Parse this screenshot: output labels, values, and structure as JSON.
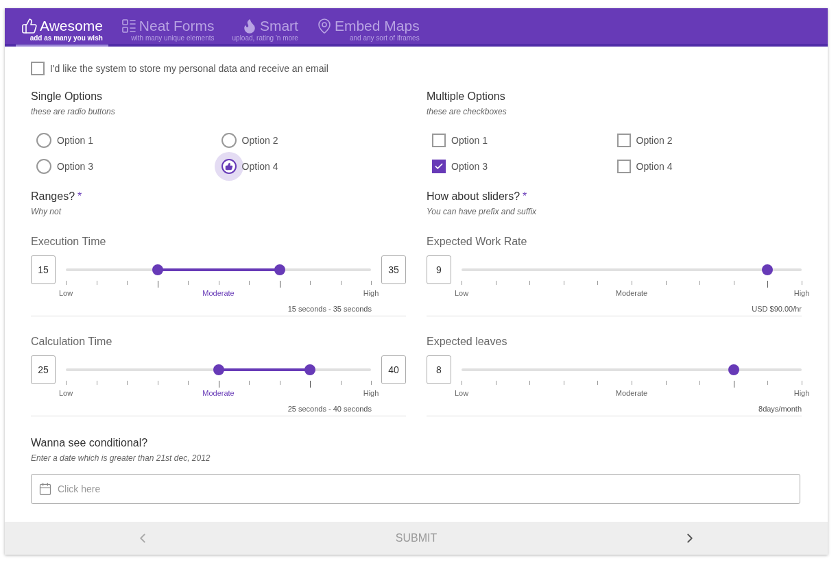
{
  "tabs": [
    {
      "title": "Awesome",
      "subtitle": "add as many you wish",
      "selected": true
    },
    {
      "title": "Neat Forms",
      "subtitle": "with many unique elements",
      "selected": false
    },
    {
      "title": "Smart",
      "subtitle": "upload, rating 'n more",
      "selected": false
    },
    {
      "title": "Embed Maps",
      "subtitle": "and any sort of iframes",
      "selected": false
    }
  ],
  "consent": {
    "label": "I'd like the system to store my personal data and receive an email",
    "checked": false
  },
  "single_options": {
    "title": "Single Options",
    "subtitle": "these are radio buttons",
    "options": [
      {
        "label": "Option 1",
        "selected": false
      },
      {
        "label": "Option 2",
        "selected": false
      },
      {
        "label": "Option 3",
        "selected": false
      },
      {
        "label": "Option 4",
        "selected": true
      }
    ]
  },
  "multiple_options": {
    "title": "Multiple Options",
    "subtitle": "these are checkboxes",
    "options": [
      {
        "label": "Option 1",
        "checked": false
      },
      {
        "label": "Option 2",
        "checked": false
      },
      {
        "label": "Option 3",
        "checked": true
      },
      {
        "label": "Option 4",
        "checked": false
      }
    ]
  },
  "ranges": {
    "title": "Ranges?",
    "required_mark": "*",
    "subtitle": "Why not",
    "sliders": [
      {
        "label": "Execution Time",
        "min_value": "15",
        "max_value": "35",
        "handles": [
          {
            "level": 0.3
          },
          {
            "level": 0.7
          }
        ],
        "scale": [
          "Low",
          "Moderate",
          "High"
        ],
        "summary": "15 seconds - 35 seconds"
      },
      {
        "label": "Calculation Time",
        "min_value": "25",
        "max_value": "40",
        "handles": [
          {
            "level": 0.5
          },
          {
            "level": 0.8
          }
        ],
        "scale": [
          "Low",
          "Moderate",
          "High"
        ],
        "summary": "25 seconds - 40 seconds"
      }
    ]
  },
  "sliders": {
    "title": "How about sliders?",
    "required_mark": "*",
    "subtitle": "You can have prefix and suffix",
    "sliders": [
      {
        "label": "Expected Work Rate",
        "value": "9",
        "handles": [
          {
            "level": 0.9
          }
        ],
        "scale": [
          "Low",
          "Moderate",
          "High"
        ],
        "summary": "USD $90.00/hr"
      },
      {
        "label": "Expected leaves",
        "value": "8",
        "handles": [
          {
            "level": 0.8
          }
        ],
        "scale": [
          "Low",
          "Moderate",
          "High"
        ],
        "summary": "8days/month"
      }
    ]
  },
  "conditional": {
    "title": "Wanna see conditional?",
    "subtitle": "Enter a date which is greater than 21st dec, 2012",
    "date_field": {
      "placeholder": "Click here"
    }
  },
  "footer": {
    "prev": {
      "disabled": true
    },
    "submit": "SUBMIT",
    "next": {
      "disabled": false
    }
  }
}
